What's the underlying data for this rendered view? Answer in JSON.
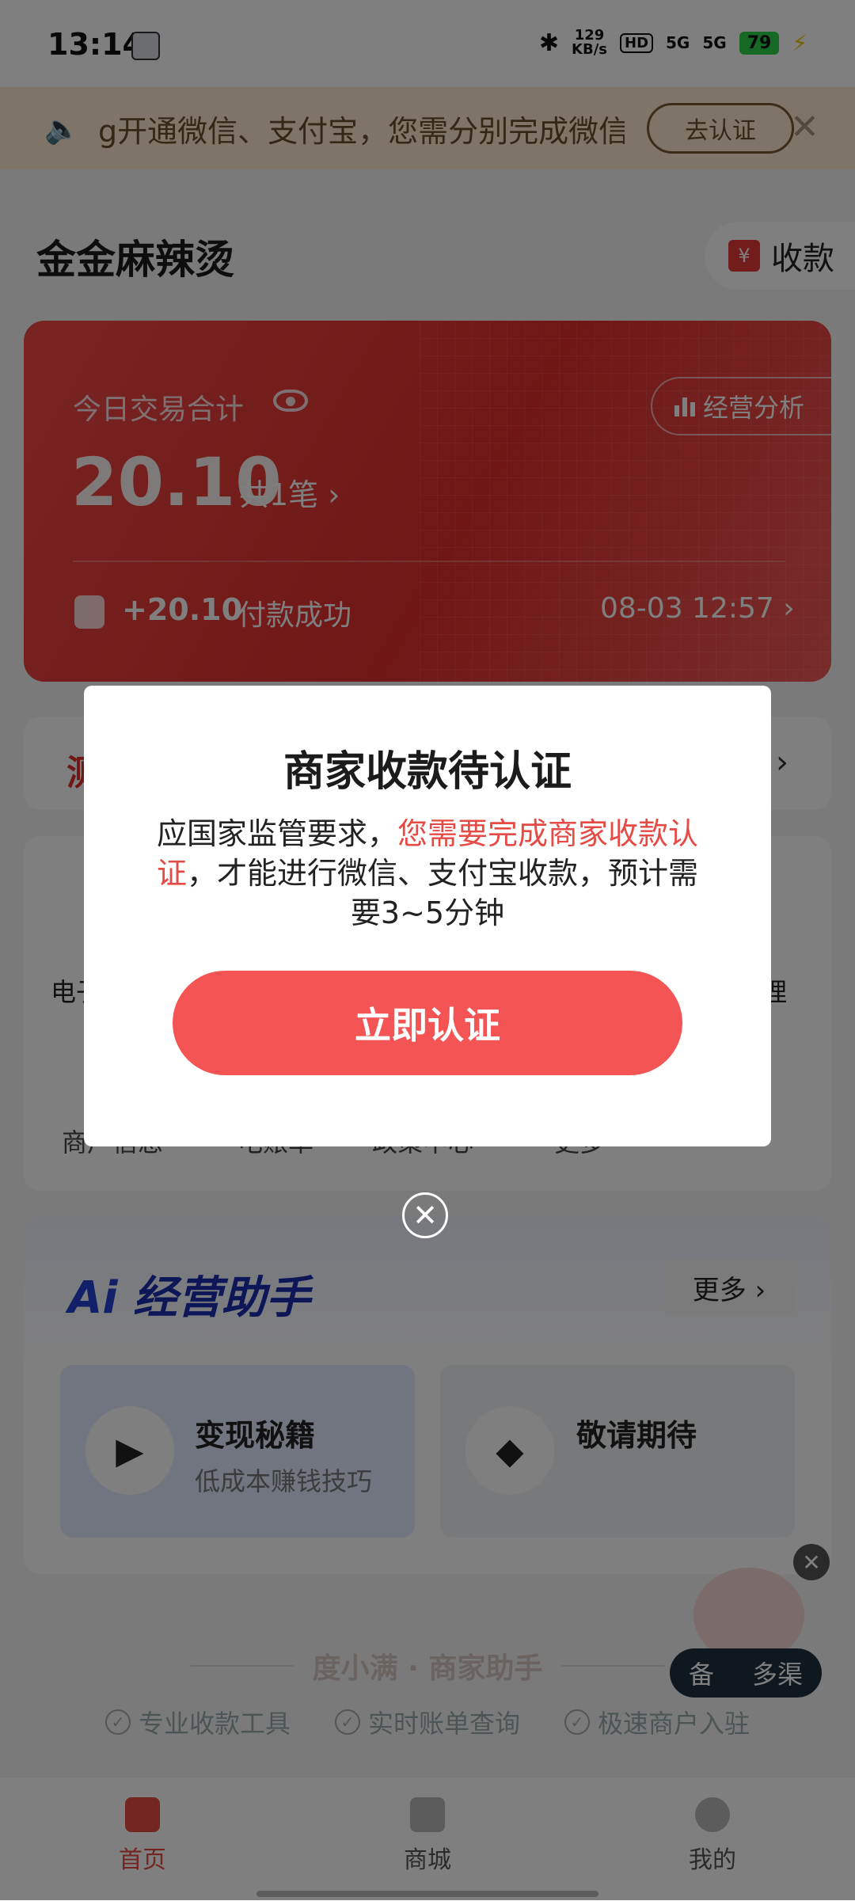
{
  "status_bar": {
    "time": "13:14",
    "network_speed_value": "129",
    "network_speed_unit": "KB/s",
    "hd_label": "HD",
    "signal_1": "5G",
    "signal_2": "5G",
    "battery": "79"
  },
  "notice": {
    "text": "g开通微信、支付宝，您需分别完成微信",
    "button_label": "去认证",
    "close_symbol": "✕"
  },
  "header": {
    "store_name": "金金麻辣烫",
    "collect_icon_text": "¥",
    "collect_label": "收款"
  },
  "summary_card": {
    "title": "今日交易合计",
    "analysis_label": "经营分析",
    "total_amount": "20.10",
    "count_text": "共1笔 ›",
    "recent_amount": "+20.10",
    "recent_status": "付款成功",
    "recent_time": "08-03 12:57 ›"
  },
  "background": {
    "promo_fragment": "测",
    "chevron": "›",
    "tool_left": "电子",
    "tool_right": "理",
    "row_labels": [
      "商户信息",
      "电账单",
      "政策中心",
      "更多"
    ],
    "ai_prefix": "Ai",
    "ai_title": "经营助手",
    "ai_more": "更多 ›",
    "ai_card_1_title": "变现秘籍",
    "ai_card_1_sub": "低成本赚钱技巧",
    "ai_card_2_title": "敬请期待",
    "brand": "度小满 · 商家助手",
    "features": [
      "专业收款工具",
      "实时账单查询",
      "极速商户入驻"
    ],
    "robot_pill_left": "备",
    "robot_pill_right": "多渠"
  },
  "bottom_nav": {
    "home": "首页",
    "mall": "商城",
    "mine": "我的"
  },
  "modal": {
    "title": "商家收款待认证",
    "body_prefix": "应国家监管要求，",
    "body_highlight": "您需要完成商家收款认证",
    "body_suffix": "，才能进行微信、支付宝收款，预计需要3~5分钟",
    "confirm_label": "立即认证",
    "close_symbol": "✕"
  },
  "colors": {
    "accent_red": "#f55454",
    "card_red": "#e02f2c",
    "highlight_red": "#e64a45",
    "notice_bg": "#fdebd1",
    "home_nav_active": "#e64a45"
  }
}
